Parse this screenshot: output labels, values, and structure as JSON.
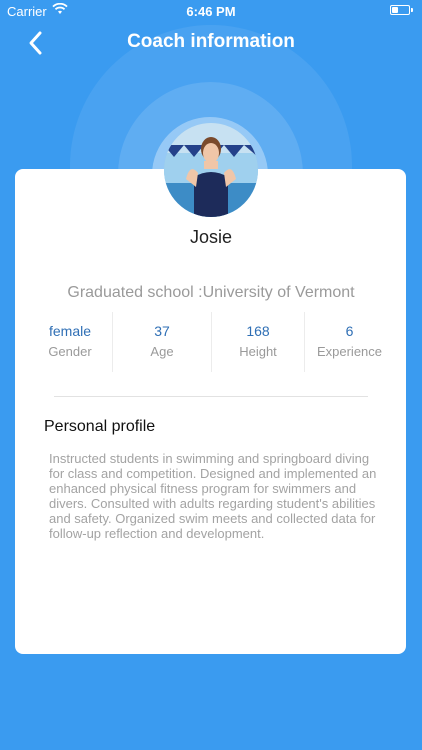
{
  "status_bar": {
    "carrier": "Carrier",
    "time": "6:46 PM"
  },
  "nav": {
    "title": "Coach information",
    "back_icon": "chevron-left-icon"
  },
  "coach": {
    "name": "Josie",
    "school": "Graduated school :University of Vermont",
    "stats": [
      {
        "value": "female",
        "label": "Gender"
      },
      {
        "value": "37",
        "label": "Age"
      },
      {
        "value": "168",
        "label": "Height"
      },
      {
        "value": "6",
        "label": "Experience"
      }
    ]
  },
  "profile": {
    "title": "Personal profile",
    "text": "Instructed students in swimming and springboard diving for class and competition.  Designed and implemented an enhanced physical fitness program for swimmers and divers. Consulted with adults regarding student's abilities and safety. Organized swim meets and collected data for follow-up reflection and development."
  },
  "colors": {
    "background": "#3a9bf0",
    "accent": "#2f6fb5"
  }
}
